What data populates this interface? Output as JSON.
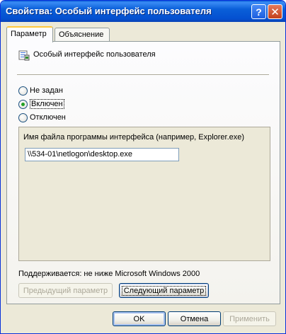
{
  "window": {
    "title": "Свойства: Особый интерфейс пользователя",
    "help_glyph": "?",
    "close_glyph": "✕"
  },
  "tabs": [
    {
      "label": "Параметр",
      "active": true
    },
    {
      "label": "Объяснение",
      "active": false
    }
  ],
  "policy": {
    "icon": "policy-setting-icon",
    "name": "Особый интерфейс пользователя"
  },
  "options": [
    {
      "label": "Не задан",
      "checked": false
    },
    {
      "label": "Включен",
      "checked": true
    },
    {
      "label": "Отключен",
      "checked": false
    }
  ],
  "option_area": {
    "field_label": "Имя файла программы интерфейса (например, Explorer.exe)",
    "field_value": "\\\\534-01\\netlogon\\desktop.exe"
  },
  "supported": {
    "text": "Поддерживается:  не ниже Microsoft Windows 2000"
  },
  "nav_buttons": {
    "prev_label": "Предыдущий параметр",
    "next_label": "Следующий параметр"
  },
  "dialog_buttons": {
    "ok_label": "OK",
    "cancel_label": "Отмена",
    "apply_label": "Применить"
  },
  "colors": {
    "titlebar": "#0a5fd8",
    "dialog_bg": "#ece9d8",
    "selected_radio": "#22a022",
    "active_tab_accent": "#ffc73c"
  }
}
